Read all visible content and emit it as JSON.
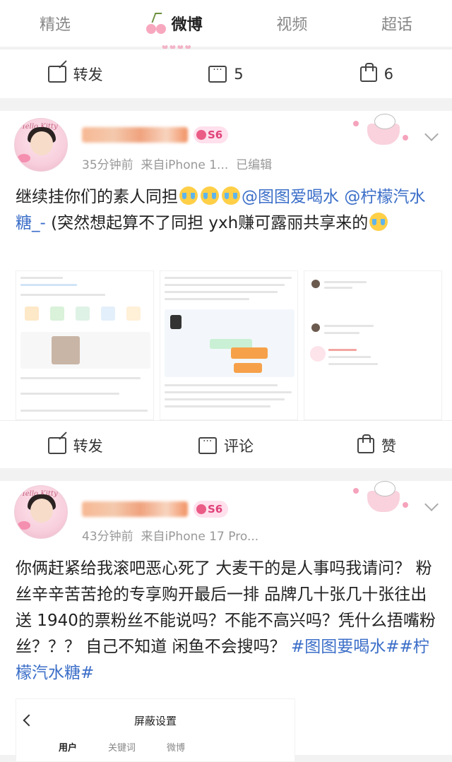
{
  "topnav": {
    "tabs": [
      "精选",
      "微博",
      "视频",
      "超话"
    ],
    "active_index": 1,
    "hearts": "♥♥♥♥"
  },
  "post0_actions": {
    "repost": "转发",
    "comments": "5",
    "likes": "6"
  },
  "post1": {
    "badge": "S6",
    "time": "35分钟前",
    "source": "来自iPhone 1...",
    "edited": "已编辑",
    "text_a": "继续挂你们的素人同担",
    "mention1": "@图图爱喝水",
    "mention2": "@柠檬汽水糖_-",
    "text_b": "(突然想起算不了同担 yxh赚可露丽共享来的",
    "actions": {
      "repost": "转发",
      "comment": "评论",
      "like": "赞"
    }
  },
  "post2": {
    "badge": "S6",
    "time": "43分钟前",
    "source": "来自iPhone 17 Pro...",
    "text": "你俩赶紧给我滚吧恶心死了 大麦干的是人事吗我请问？ 粉丝辛辛苦苦抢的专享购开最后一排 品牌几十张几十张往出送 1940的票粉丝不能说吗？不能不高兴吗？凭什么捂嘴粉丝？？？ 自己不知道 闲鱼不会搜吗？",
    "tag": "#图图要喝水##柠檬汽水糖#",
    "shot": {
      "title": "屏蔽设置",
      "tabs": [
        "用户",
        "关键词",
        "微博"
      ]
    }
  },
  "avatar_caption": "Hello Kitty",
  "icons": [
    "cherry-icon",
    "share-icon",
    "comment-icon",
    "like-icon",
    "chevron-down-icon",
    "back-icon"
  ],
  "colors": {
    "accent_link": "#3b6ec8",
    "username": "#f08a3c",
    "badge": "#e0427a"
  }
}
